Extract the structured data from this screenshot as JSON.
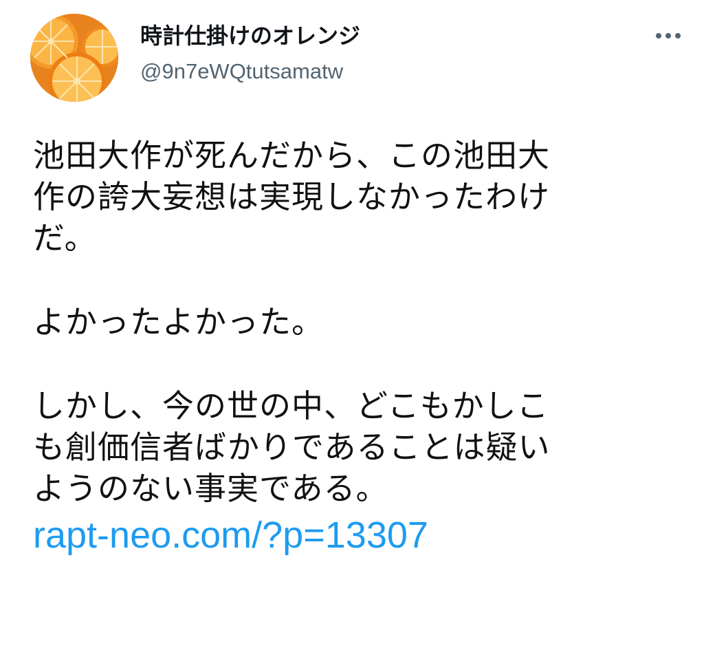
{
  "tweet": {
    "author": {
      "display_name": "時計仕掛けのオレンジ",
      "handle": "@9n7eWQtutsamatw",
      "avatar_icon": "orange-slices-avatar-icon"
    },
    "more_icon": "more-options-icon",
    "paragraphs": [
      [
        "池田大作が死んだから、この池田大",
        "作の誇大妄想は実現しなかったわけ",
        "だ。"
      ],
      [
        "よかったよかった。"
      ],
      [
        "しかし、今の世の中、どこもかしこ",
        "も創価信者ばかりであることは疑い",
        "ようのない事実である。"
      ]
    ],
    "link": "rapt-neo.com/?p=13307"
  },
  "colors": {
    "text": "#0f1419",
    "secondary": "#536471",
    "link": "#1d9bf0",
    "background": "#ffffff"
  }
}
